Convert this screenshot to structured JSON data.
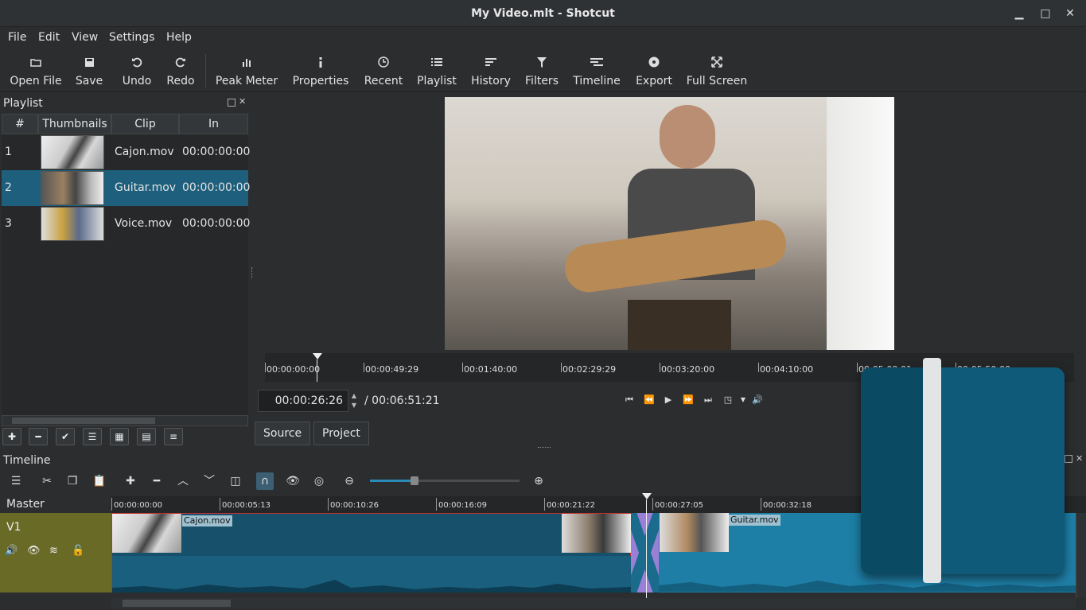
{
  "window": {
    "title": "My Video.mlt - Shotcut",
    "minimize": "▁",
    "maximize": "□",
    "close": "✕"
  },
  "menu": [
    "File",
    "Edit",
    "View",
    "Settings",
    "Help"
  ],
  "toolbar": {
    "open_file": "Open File",
    "save": "Save",
    "undo": "Undo",
    "redo": "Redo",
    "peak_meter": "Peak Meter",
    "properties": "Properties",
    "recent": "Recent",
    "playlist": "Playlist",
    "history": "History",
    "filters": "Filters",
    "timeline": "Timeline",
    "export": "Export",
    "full_screen": "Full Screen"
  },
  "playlist": {
    "title": "Playlist",
    "columns": [
      "#",
      "Thumbnails",
      "Clip",
      "In"
    ],
    "rows": [
      {
        "num": "1",
        "clip": "Cajon.mov",
        "in": "00:00:00:00"
      },
      {
        "num": "2",
        "clip": "Guitar.mov",
        "in": "00:00:00:00"
      },
      {
        "num": "3",
        "clip": "Voice.mov",
        "in": "00:00:00:00"
      }
    ],
    "selected_row": 2
  },
  "player": {
    "ruler_ticks": [
      "00:00:00:00",
      "00:00:49:29",
      "00:01:40:00",
      "00:02:29:29",
      "00:03:20:00",
      "00:04:10:00",
      "00:05:00:01",
      "00:05:50:00"
    ],
    "position": "00:00:26:26",
    "duration": "/ 00:06:51:21",
    "tabs": {
      "source": "Source",
      "project": "Project"
    }
  },
  "timeline": {
    "title": "Timeline",
    "master": "Master",
    "ruler_ticks": [
      "00:00:00:00",
      "00:00:05:13",
      "00:00:10:26",
      "00:00:16:09",
      "00:00:21:22",
      "00:00:27:05",
      "00:00:32:18"
    ],
    "track": "V1",
    "clips": [
      {
        "name": "Cajon.mov"
      },
      {
        "name": "Guitar.mov"
      }
    ],
    "zoom_level": 0.3
  },
  "colors": {
    "accent": "#1a6b8c",
    "selection": "#1d5f7c",
    "track_head": "#686a26",
    "transition": "#9a7fd6",
    "clip": "#1d6a87"
  }
}
